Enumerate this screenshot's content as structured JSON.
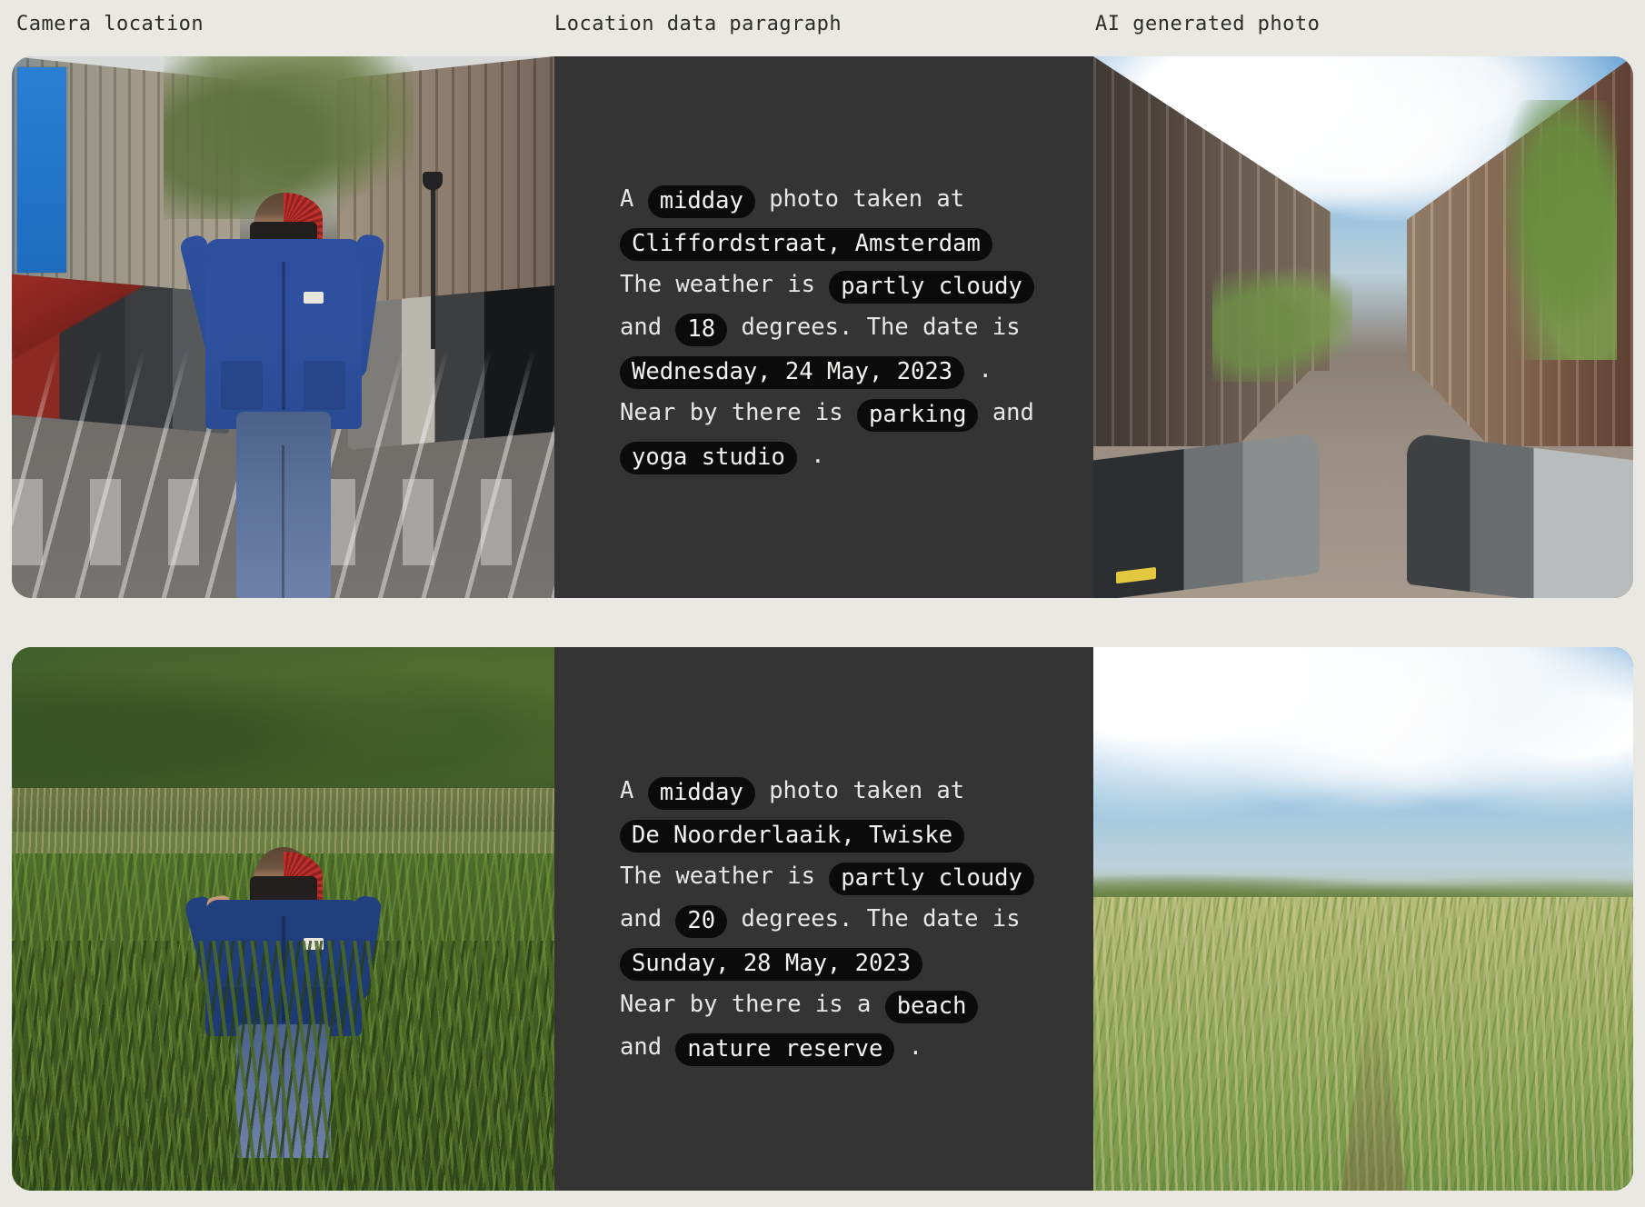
{
  "headers": {
    "camera_location": "Camera location",
    "location_data_paragraph": "Location data paragraph",
    "ai_generated_photo": "AI generated photo"
  },
  "colors": {
    "page_background": "#e9e8e2",
    "panel_background": "#343434",
    "pill_background": "#0b0b0b",
    "text": "#e7e7e5",
    "header_text": "#2c2c2c"
  },
  "rows": [
    {
      "camera_photo_alt": "person-holding-red-spiked-camera-on-amsterdam-street",
      "ai_photo_alt": "ai-generated-amsterdam-canal-street-with-parked-cars",
      "paragraph": {
        "l1_pre": "A",
        "time_of_day": "midday",
        "l1_post": "photo taken at",
        "location": "Cliffordstraat, Amsterdam",
        "l3_pre": "The weather is",
        "weather": "partly cloudy",
        "l4_pre": "and",
        "temperature": "18",
        "l4_post": "degrees. The date is",
        "date": "Wednesday, 24 May, 2023",
        "l5_period": ".",
        "l6_pre": "Near by there is",
        "poi_1": "parking",
        "l6_mid": "and",
        "poi_2": "yoga studio",
        "l7_period": "."
      }
    },
    {
      "camera_photo_alt": "person-holding-red-spiked-camera-in-tall-grass-meadow",
      "ai_photo_alt": "ai-generated-twiske-meadow-with-clouds-and-trees",
      "paragraph": {
        "l1_pre": "A",
        "time_of_day": "midday",
        "l1_post": "photo taken at",
        "location": "De Noorderlaaik, Twiske",
        "l3_pre": "The weather is",
        "weather": "partly cloudy",
        "l4_pre": "and",
        "temperature": "20",
        "l4_post": "degrees. The date is",
        "date": "Sunday, 28 May, 2023",
        "l5_period": "",
        "l6_pre": "Near by there is a",
        "poi_1": "beach",
        "l6_mid": "and",
        "poi_2": "nature reserve",
        "l7_period": "."
      }
    }
  ]
}
